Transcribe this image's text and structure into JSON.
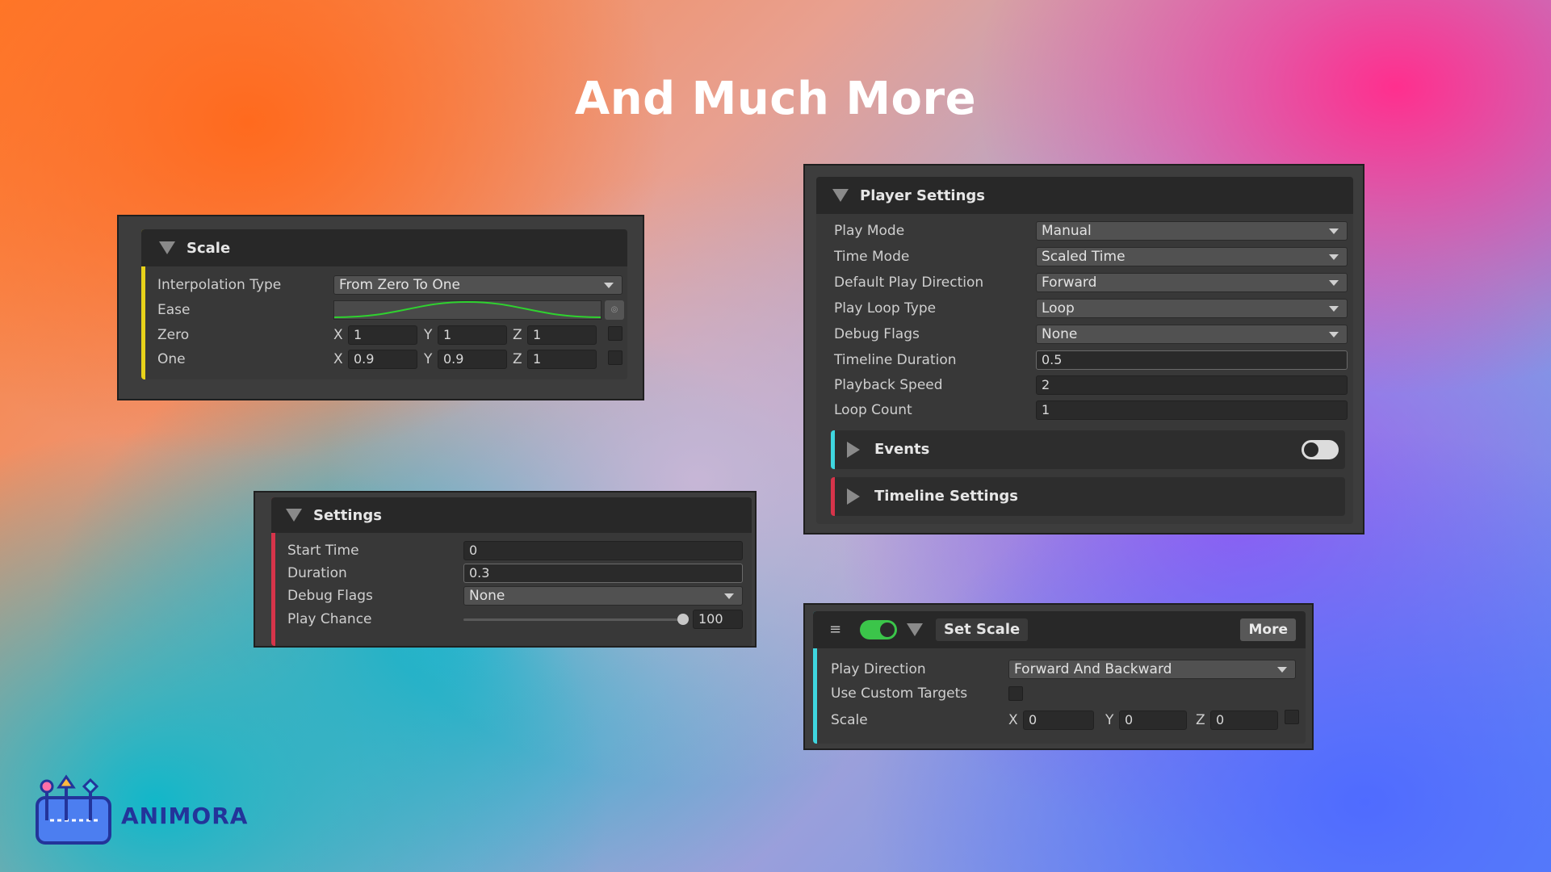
{
  "title": "And Much More",
  "brand": {
    "name": "ANIMORA"
  },
  "colors": {
    "accent_yellow": "#e8d21a",
    "accent_red": "#d6344a",
    "accent_cyan": "#3fd6df",
    "toggle_green": "#3bc54a",
    "ease_curve": "#2fd22f"
  },
  "scale_panel": {
    "header": "Scale",
    "rows": {
      "interpolation_type": {
        "label": "Interpolation Type",
        "value": "From Zero To One"
      },
      "ease": {
        "label": "Ease"
      },
      "zero": {
        "label": "Zero",
        "x_axis": "X",
        "x": "1",
        "y_axis": "Y",
        "y": "1",
        "z_axis": "Z",
        "z": "1"
      },
      "one": {
        "label": "One",
        "x_axis": "X",
        "x": "0.9",
        "y_axis": "Y",
        "y": "0.9",
        "z_axis": "Z",
        "z": "1"
      }
    }
  },
  "settings_panel": {
    "header": "Settings",
    "start_time": {
      "label": "Start Time",
      "value": "0"
    },
    "duration": {
      "label": "Duration",
      "value": "0.3"
    },
    "debug_flags": {
      "label": "Debug Flags",
      "value": "None"
    },
    "play_chance": {
      "label": "Play Chance",
      "value": "100",
      "fraction": 1.0
    }
  },
  "player_settings_panel": {
    "header": "Player Settings",
    "play_mode": {
      "label": "Play Mode",
      "value": "Manual"
    },
    "time_mode": {
      "label": "Time Mode",
      "value": "Scaled Time"
    },
    "default_play_direction": {
      "label": "Default Play Direction",
      "value": "Forward"
    },
    "play_loop_type": {
      "label": "Play Loop Type",
      "value": "Loop"
    },
    "debug_flags": {
      "label": "Debug Flags",
      "value": "None"
    },
    "timeline_duration": {
      "label": "Timeline Duration",
      "value": "0.5"
    },
    "playback_speed": {
      "label": "Playback Speed",
      "value": "2"
    },
    "loop_count": {
      "label": "Loop Count",
      "value": "1"
    },
    "events": {
      "label": "Events",
      "toggle_on": false
    },
    "timeline_settings": {
      "label": "Timeline Settings"
    }
  },
  "set_scale_panel": {
    "header": "Set Scale",
    "enabled": true,
    "more_button": "More",
    "play_direction": {
      "label": "Play Direction",
      "value": "Forward And Backward"
    },
    "use_custom_targets": {
      "label": "Use Custom Targets",
      "checked": false
    },
    "scale": {
      "label": "Scale",
      "x_axis": "X",
      "x": "0",
      "y_axis": "Y",
      "y": "0",
      "z_axis": "Z",
      "z": "0"
    }
  }
}
